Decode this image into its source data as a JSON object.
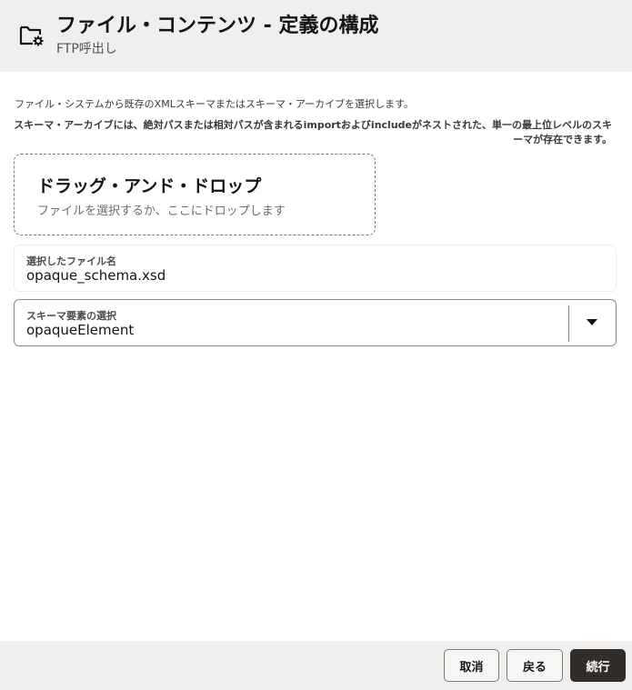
{
  "header": {
    "icon": "folder-gear-icon",
    "title": "ファイル・コンテンツ - 定義の構成",
    "subtitle": "FTP呼出し"
  },
  "description": {
    "line1": "ファイル・システムから既存のXMLスキーマまたはスキーマ・アーカイブを選択します。",
    "line2": "スキーマ・アーカイブには、絶対パスまたは相対パスが含まれるimportおよびincludeがネストされた、単一の最上位レベルのスキーマが存在できます。"
  },
  "dropzone": {
    "title": "ドラッグ・アンド・ドロップ",
    "hint": "ファイルを選択するか、ここにドロップします"
  },
  "selected_file": {
    "label": "選択したファイル名",
    "value": "opaque_schema.xsd"
  },
  "schema_element": {
    "label": "スキーマ要素の選択",
    "value": "opaqueElement",
    "icon": "chevron-down-icon"
  },
  "footer": {
    "cancel_label": "取消",
    "back_label": "戻る",
    "continue_label": "続行"
  },
  "colors": {
    "header_bg": "#f1efed",
    "primary_button": "#312d2a"
  }
}
